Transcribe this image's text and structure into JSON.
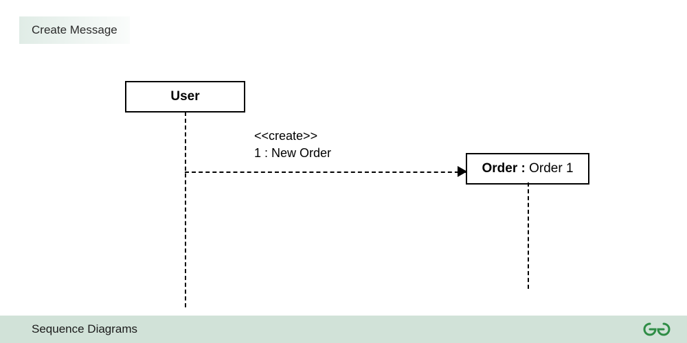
{
  "header": {
    "title": "Create Message"
  },
  "diagram": {
    "actor_user": "User",
    "actor_order_prefix": "Order : ",
    "actor_order_name": "Order 1",
    "message_stereotype": "<<create>>",
    "message_text": "1 : New Order"
  },
  "footer": {
    "caption": "Sequence Diagrams",
    "logo_name": "geeksforgeeks"
  }
}
